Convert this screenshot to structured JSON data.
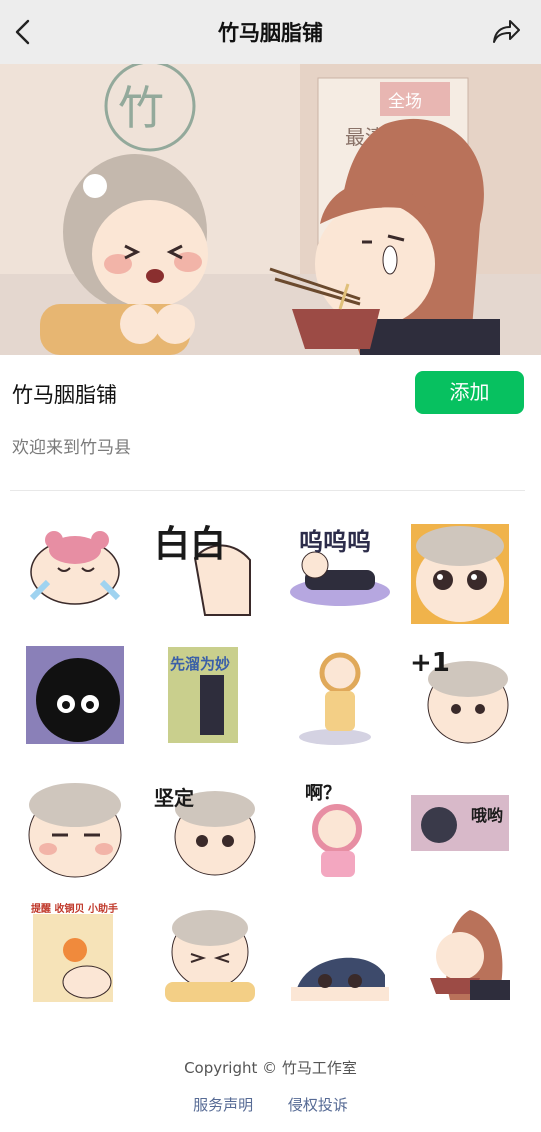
{
  "nav": {
    "title": "竹马胭脂铺"
  },
  "banner": {
    "sign_text": "竹",
    "tag_text": "全场",
    "poster_text": "最清"
  },
  "pack": {
    "title": "竹马胭脂铺",
    "add_label": "添加",
    "description": "欢迎来到竹马县"
  },
  "stickers": [
    {
      "name": "sticker-crying-girl",
      "text": ""
    },
    {
      "name": "sticker-white-hand",
      "text": "白白"
    },
    {
      "name": "sticker-wuwuwu",
      "text": "呜呜呜"
    },
    {
      "name": "sticker-teary-eyes",
      "text": ""
    },
    {
      "name": "sticker-black-fluff",
      "text": ""
    },
    {
      "name": "sticker-xian-liu",
      "text": "先溜为妙"
    },
    {
      "name": "sticker-standing-girl",
      "text": ""
    },
    {
      "name": "sticker-plus-one",
      "text": "+1"
    },
    {
      "name": "sticker-grumpy-face",
      "text": ""
    },
    {
      "name": "sticker-jianding",
      "text": "坚定"
    },
    {
      "name": "sticker-a-question",
      "text": "啊？"
    },
    {
      "name": "sticker-oyo",
      "text": "哦哟"
    },
    {
      "name": "sticker-reminder",
      "text": "提醒 收铜贝 小助手"
    },
    {
      "name": "sticker-hug",
      "text": ""
    },
    {
      "name": "sticker-peeking",
      "text": ""
    },
    {
      "name": "sticker-noodles",
      "text": ""
    }
  ],
  "footer": {
    "copyright": "Copyright © 竹马工作室",
    "service_link": "服务声明",
    "report_link": "侵权投诉"
  },
  "colors": {
    "accent": "#07c160",
    "link": "#576b95",
    "nav_bg": "#ededed"
  }
}
